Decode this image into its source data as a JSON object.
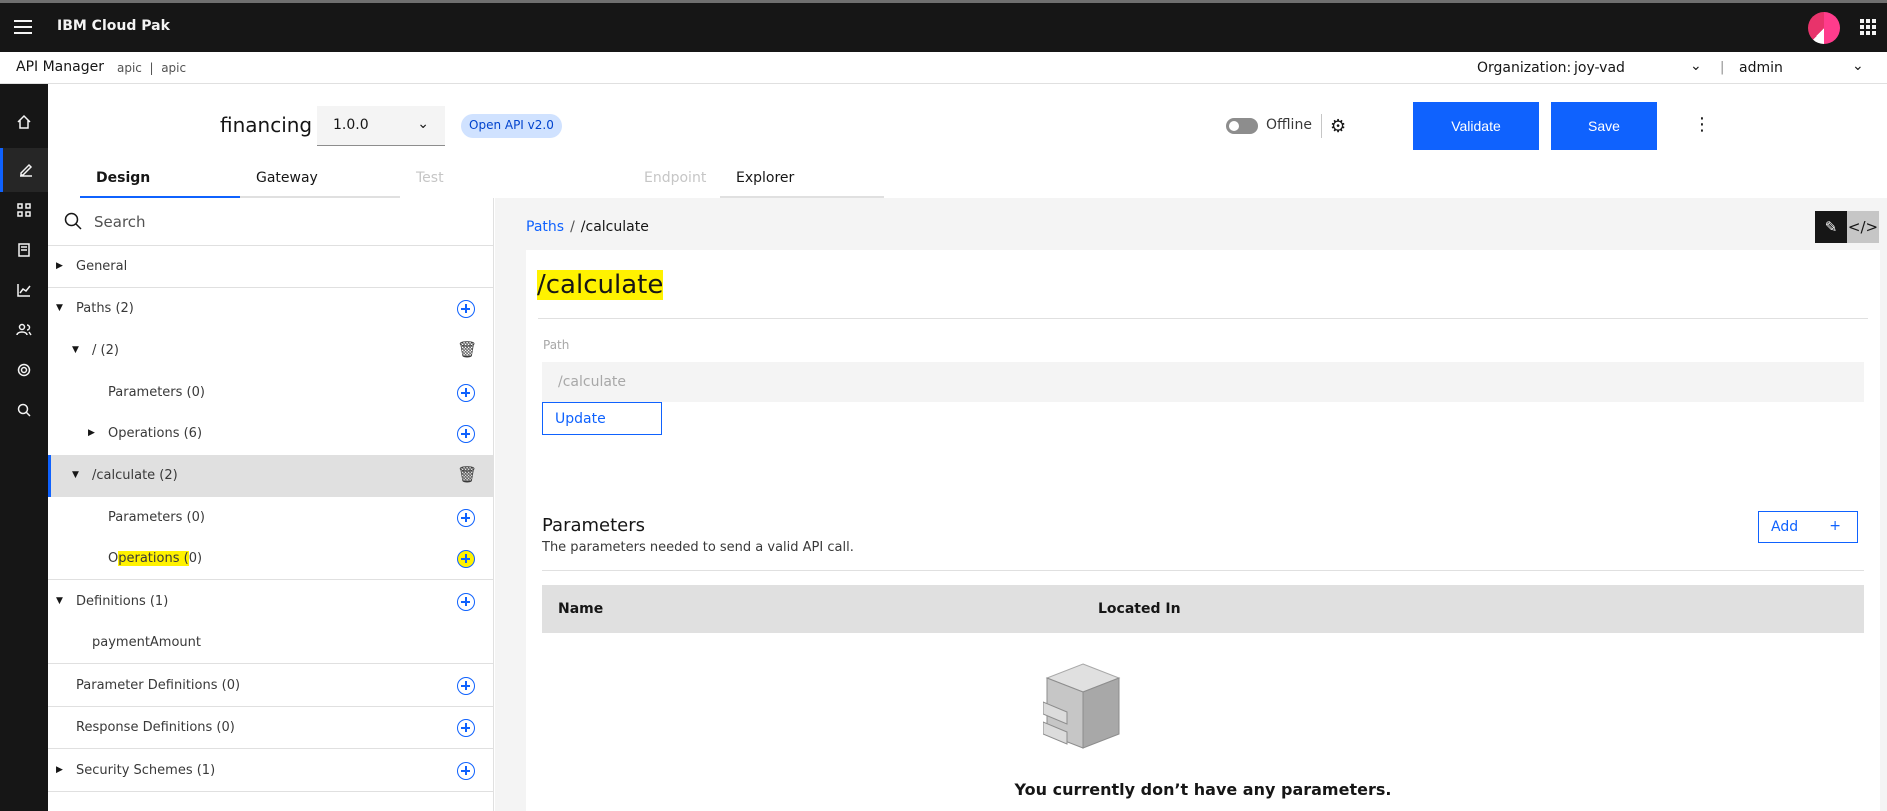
{
  "topbar": {
    "brand": "IBM Cloud Pak"
  },
  "subheader": {
    "app": "API Manager",
    "context": "apic  |  apic",
    "org_label": "Organization:",
    "org_value": "joy-vad",
    "separator": "|",
    "user": "admin"
  },
  "api": {
    "title": "financing",
    "version": "1.0.0",
    "badge": "Open API v2.0",
    "toggle_label": "Offline",
    "validate": "Validate",
    "save": "Save"
  },
  "tabs": [
    "Design",
    "Gateway",
    "Test",
    "Endpoint",
    "Explorer"
  ],
  "search": {
    "placeholder": "Search"
  },
  "tree": {
    "general": "General",
    "paths": "Paths (2)",
    "root": "/ (2)",
    "root_params": "Parameters (0)",
    "root_ops": "Operations (6)",
    "calc": "/calculate (2)",
    "calc_params": "Parameters (0)",
    "calc_ops_a": "O",
    "calc_ops_b": "perations (",
    "calc_ops_c": "0)",
    "definitions": "Definitions (1)",
    "payment": "paymentAmount",
    "param_defs": "Parameter Definitions (0)",
    "resp_defs": "Response Definitions (0)",
    "security": "Security Schemes (1)"
  },
  "breadcrumb": {
    "root": "Paths",
    "separator": "/",
    "current": "/calculate"
  },
  "editor": {
    "title": "/calculate",
    "field_label": "Path",
    "field_value": "/calculate",
    "update": "Update"
  },
  "parameters": {
    "title": "Parameters",
    "subtitle": "The parameters needed to send a valid API call.",
    "add": "Add",
    "add_plus": "+",
    "col_name": "Name",
    "col_located": "Located In",
    "empty": "You currently don’t have any parameters."
  },
  "highlight_color": "#fff200",
  "accent_color": "#0f62fe"
}
